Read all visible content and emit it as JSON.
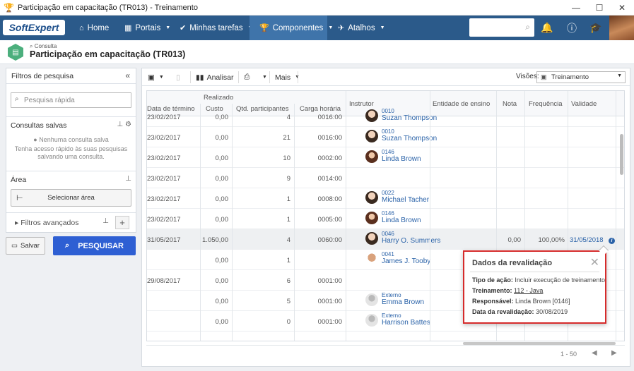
{
  "window": {
    "title": "Participação em capacitação (TR013) - Treinamento"
  },
  "navbar": {
    "logo": "SoftExpert",
    "items": [
      {
        "label": "Home"
      },
      {
        "label": "Portais"
      },
      {
        "label": "Minhas tarefas"
      },
      {
        "label": "Componentes"
      },
      {
        "label": "Atalhos"
      }
    ],
    "search_value": ""
  },
  "header": {
    "subtitle": "Consulta",
    "title": "Participação em capacitação (TR013)"
  },
  "left": {
    "title": "Filtros de pesquisa",
    "quick_search_placeholder": "Pesquisa rápida",
    "saved_title": "Consultas salvas",
    "saved_empty": "Nenhuma consulta salva",
    "saved_hint_1": "Tenha acesso rápido às suas pesquisas",
    "saved_hint_2": "salvando uma consulta.",
    "area_title": "Área",
    "area_button": "Selecionar área",
    "advanced": "Filtros avançados",
    "save_button": "Salvar",
    "search_button": "PESQUISAR"
  },
  "toolbar": {
    "analyze": "Analisar",
    "more": "Mais",
    "views_label": "Visões:",
    "views_value": "Treinamento"
  },
  "grid": {
    "group_header": "Realizado",
    "columns": [
      "Data de término",
      "Custo",
      "Qtd. participantes",
      "Carga horária",
      "Instrutor",
      "Entidade de ensino",
      "Nota",
      "Frequência",
      "Validade"
    ],
    "rows": [
      {
        "end": "23/02/2017",
        "cost": "0,00",
        "qty": "4",
        "load": "0016:00",
        "code": "0010",
        "name": "Suzan Thompson",
        "ava": "m1",
        "note": "",
        "freq": "",
        "valid": ""
      },
      {
        "end": "23/02/2017",
        "cost": "0,00",
        "qty": "21",
        "load": "0016:00",
        "code": "0010",
        "name": "Suzan Thompson",
        "ava": "m1",
        "note": "",
        "freq": "",
        "valid": ""
      },
      {
        "end": "23/02/2017",
        "cost": "0,00",
        "qty": "10",
        "load": "0002:00",
        "code": "0146",
        "name": "Linda Brown",
        "ava": "f1",
        "note": "",
        "freq": "",
        "valid": ""
      },
      {
        "end": "23/02/2017",
        "cost": "0,00",
        "qty": "9",
        "load": "0014:00",
        "code": "",
        "name": "",
        "ava": "",
        "note": "",
        "freq": "",
        "valid": ""
      },
      {
        "end": "23/02/2017",
        "cost": "0,00",
        "qty": "1",
        "load": "0008:00",
        "code": "0022",
        "name": "Michael Tacher",
        "ava": "m1",
        "note": "",
        "freq": "",
        "valid": ""
      },
      {
        "end": "23/02/2017",
        "cost": "0,00",
        "qty": "1",
        "load": "0005:00",
        "code": "0146",
        "name": "Linda Brown",
        "ava": "f1",
        "note": "",
        "freq": "",
        "valid": ""
      },
      {
        "end": "31/05/2017",
        "cost": "1.050,00",
        "qty": "4",
        "load": "0060:00",
        "code": "0046",
        "name": "Harry O. Summers",
        "ava": "m1",
        "note": "0,00",
        "freq": "100,00%",
        "valid": "31/05/2018"
      },
      {
        "end": "",
        "cost": "0,00",
        "qty": "1",
        "load": "",
        "code": "0041",
        "name": "James J. Tooby",
        "ava": "bald",
        "note": "",
        "freq": "",
        "valid": ""
      },
      {
        "end": "29/08/2017",
        "cost": "0,00",
        "qty": "6",
        "load": "0001:00",
        "code": "",
        "name": "",
        "ava": "",
        "note": "",
        "freq": "",
        "valid": ""
      },
      {
        "end": "",
        "cost": "0,00",
        "qty": "5",
        "load": "0001:00",
        "code": "Externo",
        "name": "Emma Brown",
        "ava": "gen",
        "note": "",
        "freq": "",
        "valid": ""
      },
      {
        "end": "",
        "cost": "0,00",
        "qty": "0",
        "load": "0001:00",
        "code": "Externo",
        "name": "Harrison Battes",
        "ava": "gen",
        "note": "",
        "freq": "",
        "valid": ""
      }
    ]
  },
  "pager": {
    "range": "1 - 50"
  },
  "popup": {
    "title": "Dados da revalidação",
    "action_label": "Tipo de ação:",
    "action_value": "Incluir execução de treinamento",
    "training_label": "Treinamento:",
    "training_value": "112 - Java",
    "responsible_label": "Responsável:",
    "responsible_value": "Linda Brown [0146]",
    "date_label": "Data da revalidação:",
    "date_value": "30/08/2019"
  }
}
